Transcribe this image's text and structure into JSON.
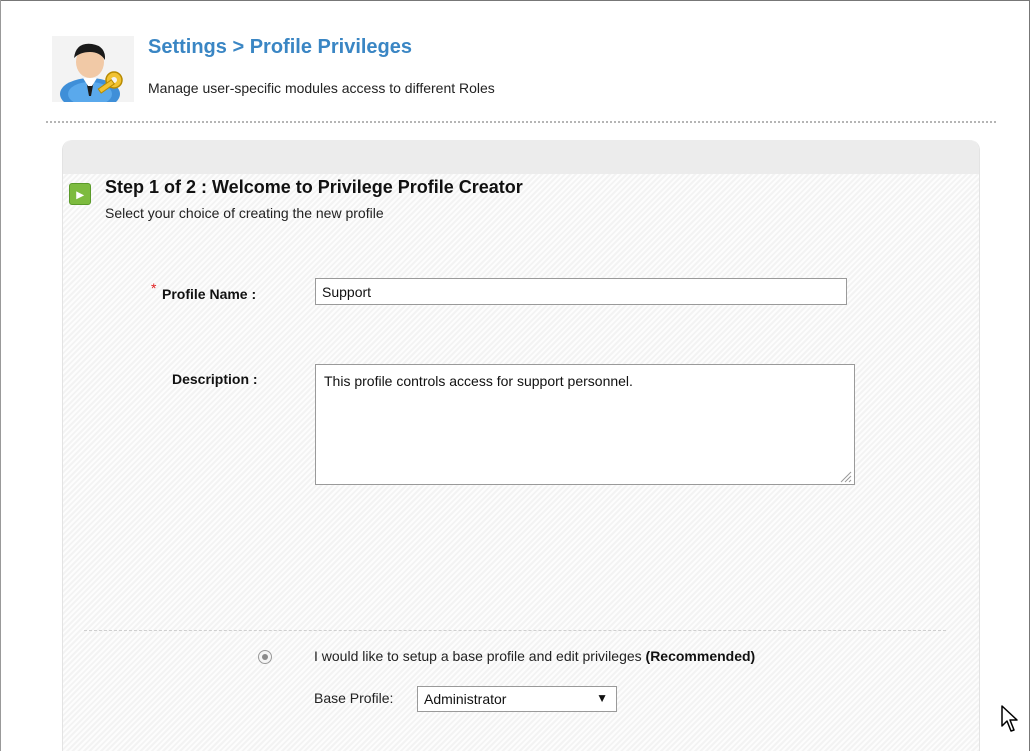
{
  "header": {
    "breadcrumb_settings": "Settings",
    "breadcrumb_sep": ">",
    "breadcrumb_page": "Profile Privileges",
    "subtitle": "Manage user-specific modules access to different Roles"
  },
  "step": {
    "title": "Step 1 of 2 : Welcome to Privilege Profile Creator",
    "subtitle": "Select your choice of creating the new profile"
  },
  "form": {
    "required_mark": "*",
    "profile_name_label": "Profile Name :",
    "profile_name_value": "Support",
    "description_label": "Description :",
    "description_value": "This profile controls access for support personnel."
  },
  "option": {
    "text": "I would like to setup a base profile and edit privileges",
    "emphasis": "(Recommended)",
    "selected": true
  },
  "base_profile": {
    "label": "Base Profile:",
    "value": "Administrator"
  },
  "icons": {
    "avatar": "user-key-icon",
    "step": "arrow-right-icon",
    "caret": "caret-down-icon",
    "cursor": "mouse-pointer-icon"
  },
  "colors": {
    "title_blue": "#3a86c4",
    "step_green": "#7dbb3f",
    "required_red": "#e02020"
  }
}
